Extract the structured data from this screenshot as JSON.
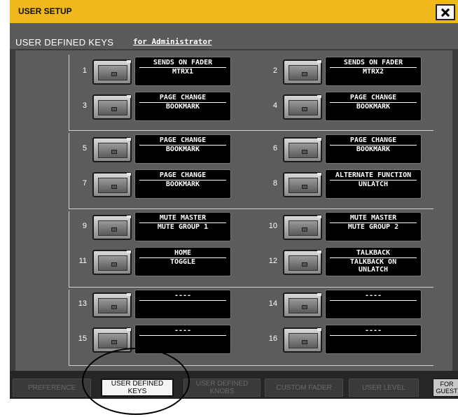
{
  "window": {
    "title": "USER SETUP"
  },
  "header": {
    "title": "USER DEFINED KEYS",
    "for_user": "for Administrator"
  },
  "keys": [
    {
      "num": "1",
      "line1": "SENDS ON FADER",
      "line2": "MTRX1"
    },
    {
      "num": "2",
      "line1": "SENDS ON FADER",
      "line2": "MTRX2"
    },
    {
      "num": "3",
      "line1": "PAGE CHANGE",
      "line2": "BOOKMARK"
    },
    {
      "num": "4",
      "line1": "PAGE CHANGE",
      "line2": "BOOKMARK"
    },
    {
      "num": "5",
      "line1": "PAGE CHANGE",
      "line2": "BOOKMARK"
    },
    {
      "num": "6",
      "line1": "PAGE CHANGE",
      "line2": "BOOKMARK"
    },
    {
      "num": "7",
      "line1": "PAGE CHANGE",
      "line2": "BOOKMARK"
    },
    {
      "num": "8",
      "line1": "ALTERNATE FUNCTION",
      "line2": "UNLATCH"
    },
    {
      "num": "9",
      "line1": "MUTE MASTER",
      "line2": "MUTE GROUP 1"
    },
    {
      "num": "10",
      "line1": "MUTE MASTER",
      "line2": "MUTE GROUP 2"
    },
    {
      "num": "11",
      "line1": "HOME",
      "line2": "TOGGLE"
    },
    {
      "num": "12",
      "line1": "TALKBACK",
      "line2": "TALKBACK ON\nUNLATCH"
    },
    {
      "num": "13",
      "line1": "----",
      "line2": ""
    },
    {
      "num": "14",
      "line1": "----",
      "line2": ""
    },
    {
      "num": "15",
      "line1": "----",
      "line2": ""
    },
    {
      "num": "16",
      "line1": "----",
      "line2": ""
    }
  ],
  "tabs": [
    {
      "label": "PREFERENCE"
    },
    {
      "label": "USER DEFINED KEYS",
      "line1": "USER DEFINED",
      "line2": "KEYS"
    },
    {
      "label": "USER DEFINED KNOBS",
      "line1": "USER DEFINED",
      "line2": "KNOBS"
    },
    {
      "label": "CUSTOM FADER"
    },
    {
      "label": "USER LEVEL"
    },
    {
      "label": "FOR GUEST",
      "line1": "FOR",
      "line2": "GUEST"
    }
  ],
  "colors": {
    "title_bar": "#f0b81c",
    "panel": "#5c5c5c",
    "lcd": "#000000"
  },
  "icons": {
    "close": "close-icon",
    "key": "key-button"
  }
}
